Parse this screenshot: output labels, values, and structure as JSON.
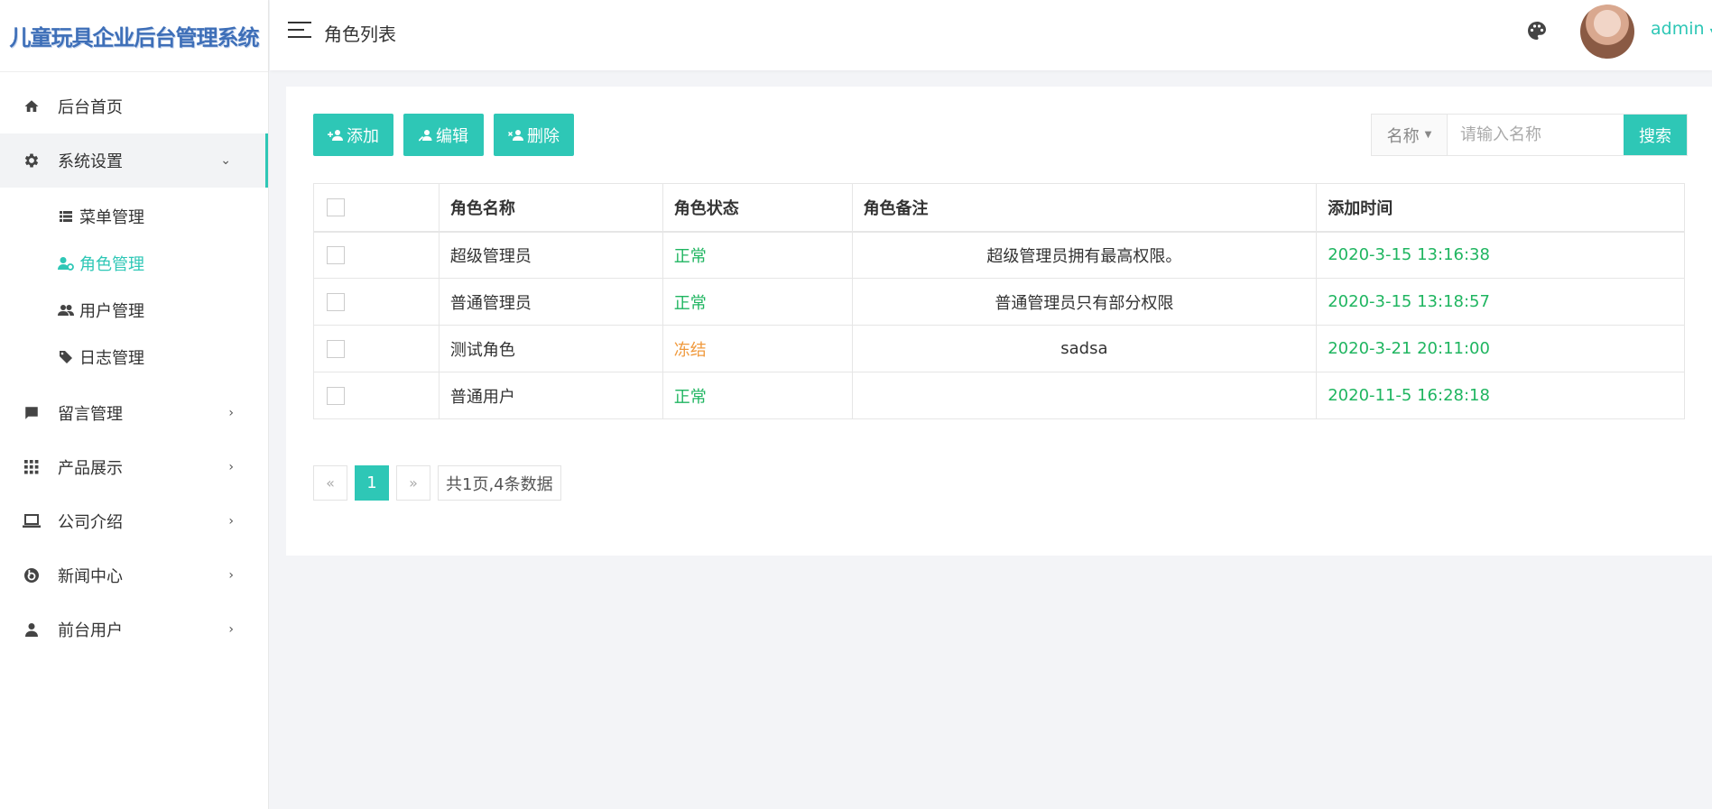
{
  "app": {
    "title": "儿童玩具企业后台管理系统"
  },
  "sidebar": {
    "home": {
      "label": "后台首页",
      "icon": "home-icon"
    },
    "system": {
      "label": "系统设置",
      "icon": "gear-icon",
      "children": [
        {
          "label": "菜单管理",
          "icon": "list-icon"
        },
        {
          "label": "角色管理",
          "icon": "role-icon"
        },
        {
          "label": "用户管理",
          "icon": "users-icon"
        },
        {
          "label": "日志管理",
          "icon": "tags-icon"
        }
      ]
    },
    "others": [
      {
        "label": "留言管理",
        "icon": "comment-icon"
      },
      {
        "label": "产品展示",
        "icon": "grid-icon"
      },
      {
        "label": "公司介绍",
        "icon": "laptop-icon"
      },
      {
        "label": "新闻中心",
        "icon": "news-icon"
      },
      {
        "label": "前台用户",
        "icon": "user-icon"
      }
    ]
  },
  "header": {
    "title": "角色列表",
    "username": "admin"
  },
  "toolbar": {
    "add": "添加",
    "edit": "编辑",
    "delete": "删除"
  },
  "search": {
    "field": "名称",
    "placeholder": "请输入名称",
    "button": "搜索"
  },
  "table": {
    "columns": [
      "角色名称",
      "角色状态",
      "角色备注",
      "添加时间"
    ],
    "rows": [
      {
        "name": "超级管理员",
        "status": "正常",
        "remark": "超级管理员拥有最高权限。",
        "time": "2020-3-15 13:16:38"
      },
      {
        "name": "普通管理员",
        "status": "正常",
        "remark": "普通管理员只有部分权限",
        "time": "2020-3-15 13:18:57"
      },
      {
        "name": "测试角色",
        "status": "冻结",
        "remark": "sadsa",
        "time": "2020-3-21 20:11:00"
      },
      {
        "name": "普通用户",
        "status": "正常",
        "remark": "",
        "time": "2020-11-5 16:28:18"
      }
    ]
  },
  "pagination": {
    "prev": "«",
    "current": "1",
    "next": "»",
    "info": "共1页,4条数据"
  },
  "colors": {
    "accent": "#2ec7b6",
    "normal": "#1fb560",
    "frozen": "#f09a3e"
  }
}
